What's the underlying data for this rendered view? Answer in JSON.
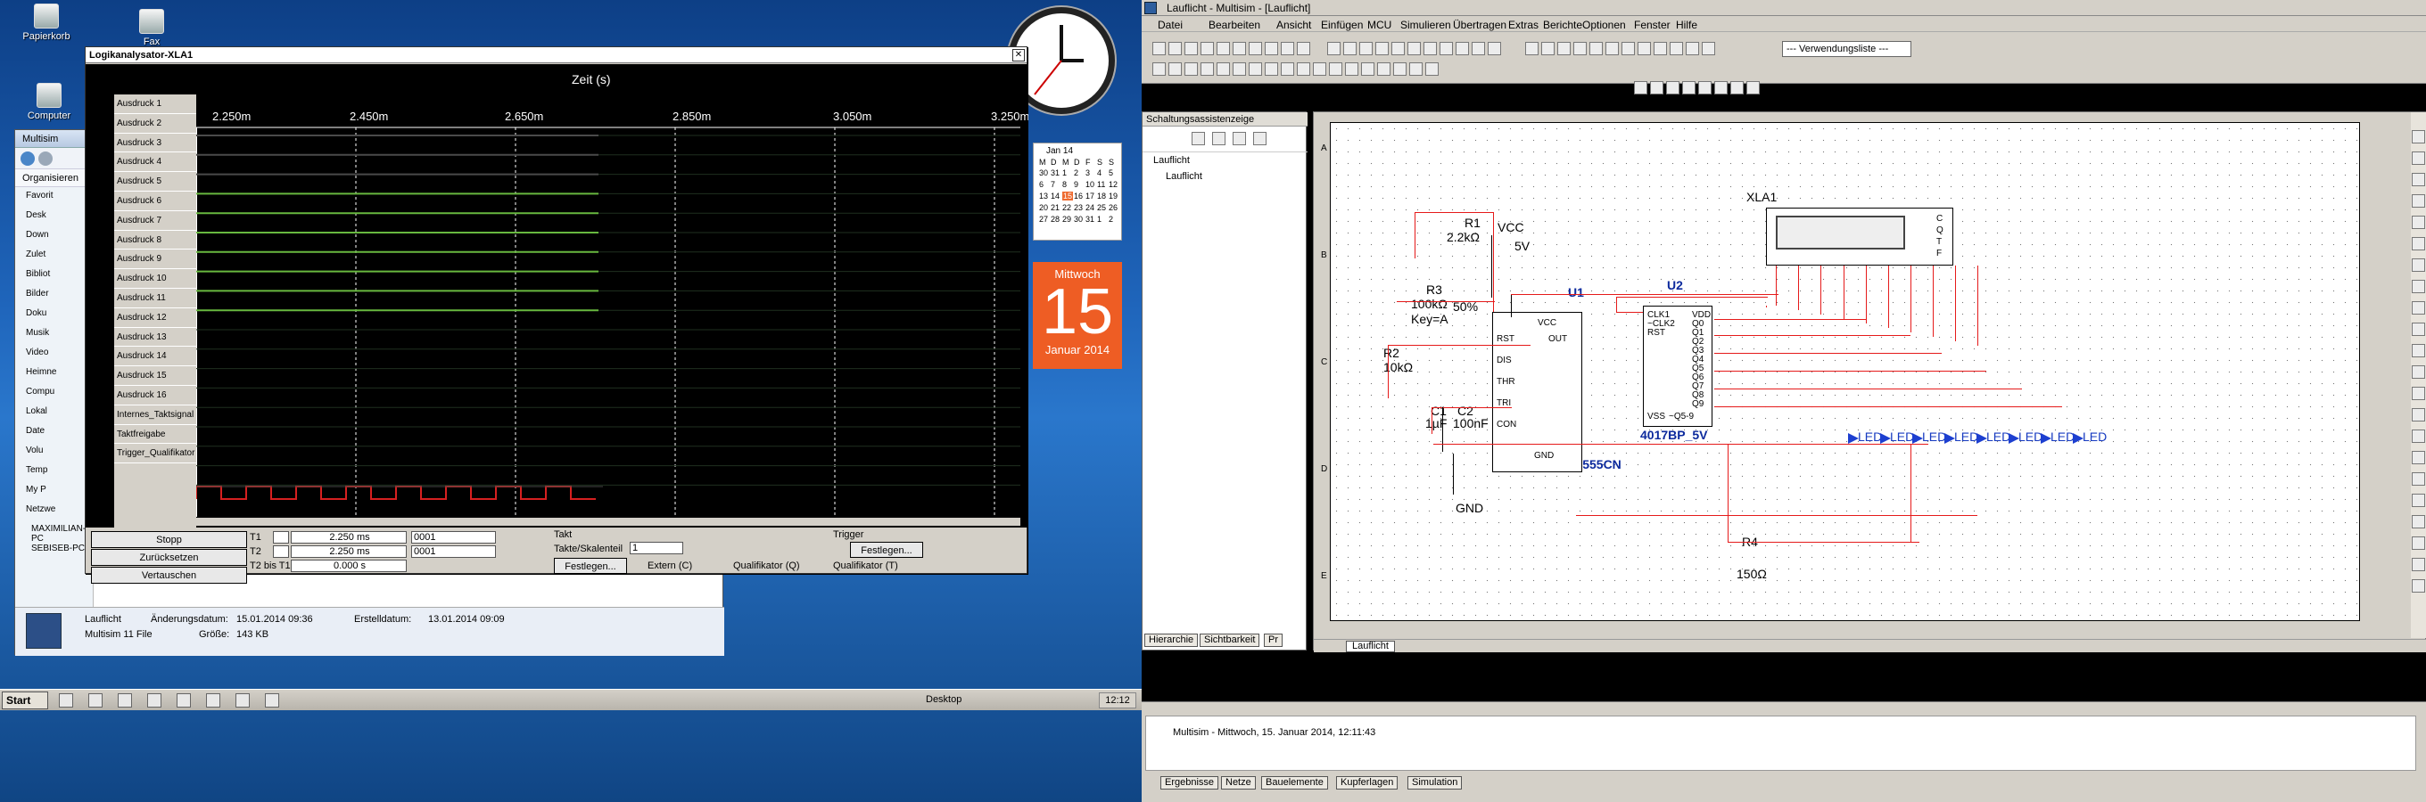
{
  "desktop": {
    "icons": [
      {
        "label": "Papierkorb",
        "icon": "recycle-bin-icon"
      },
      {
        "label": "Fax",
        "icon": "fax-icon"
      },
      {
        "label": "Computer",
        "icon": "computer-icon"
      }
    ]
  },
  "analyzer": {
    "title": "Logikanalysator-XLA1",
    "axis_title": "Zeit (s)",
    "ticks": [
      "2.250m",
      "2.450m",
      "2.650m",
      "2.850m",
      "3.050m",
      "3.250m"
    ],
    "signals": [
      "Ausdruck 1",
      "Ausdruck 2",
      "Ausdruck 3",
      "Ausdruck 4",
      "Ausdruck 5",
      "Ausdruck 6",
      "Ausdruck 7",
      "Ausdruck 8",
      "Ausdruck 9",
      "Ausdruck 10",
      "Ausdruck 11",
      "Ausdruck 12",
      "Ausdruck 13",
      "Ausdruck 14",
      "Ausdruck 15",
      "Ausdruck 16",
      "Internes_Taktsignal",
      "Taktfreigabe",
      "Trigger_Qualifikator"
    ],
    "buttons": {
      "stop": "Stopp",
      "reset": "Zurücksetzen",
      "reverse": "Vertauschen"
    },
    "time_rows": [
      {
        "label": "T1",
        "time": "2.250 ms",
        "value": "0001"
      },
      {
        "label": "T2",
        "time": "2.250 ms",
        "value": "0001"
      },
      {
        "label": "T2 bis T1",
        "time": "0.000 s",
        "value": ""
      }
    ],
    "clock": {
      "title": "Takt",
      "cycles_label": "Takte/Skalenteil",
      "cycles_value": "1",
      "set_button": "Festlegen...",
      "external": "Extern (C)",
      "qualifier": "Qualifikator (Q)"
    },
    "trigger": {
      "title": "Trigger",
      "set_button": "Festlegen...",
      "qualifier": "Qualifikator (T)"
    }
  },
  "explorer": {
    "title": "Multisim",
    "toolbar_label": "Organisieren",
    "nav_items": [
      "Favorit",
      "Desk",
      "Down",
      "Zulet",
      "Bibliot",
      "Bilder",
      "Doku",
      "Musik",
      "Video",
      "Heimne",
      "Compu",
      "Lokal",
      "Date",
      "Volu",
      "Temp",
      "My P",
      "Netzwe",
      "MAXIMILIAN-PC",
      "SEBISEB-PC"
    ],
    "file": {
      "name": "Lauflicht",
      "type": "Multisim 11 File",
      "modified_label": "Änderungsdatum:",
      "modified": "15.01.2014 09:36",
      "created_label": "Erstelldatum:",
      "created": "13.01.2014 09:09",
      "size_label": "Größe:",
      "size": "143 KB"
    }
  },
  "calendar": {
    "month": "Jan 14",
    "weekdays": [
      "M",
      "D",
      "M",
      "D",
      "F",
      "S",
      "S"
    ],
    "days": [
      "30",
      "31",
      "1",
      "2",
      "3",
      "4",
      "5",
      "6",
      "7",
      "8",
      "9",
      "10",
      "11",
      "12",
      "13",
      "14",
      "15",
      "16",
      "17",
      "18",
      "19",
      "20",
      "21",
      "22",
      "23",
      "24",
      "25",
      "26",
      "27",
      "28",
      "29",
      "30",
      "31",
      "1",
      "2"
    ],
    "weekday": "Mittwoch",
    "day": "15",
    "month_year": "Januar 2014"
  },
  "taskbar": {
    "start": "Start",
    "desktop": "Desktop",
    "time": "12:12"
  },
  "multisim": {
    "title": "Lauflicht - Multisim - [Lauflicht]",
    "menu": [
      "Datei",
      "Bearbeiten",
      "Ansicht",
      "Einfügen",
      "MCU",
      "Simulieren",
      "Übertragen",
      "Extras",
      "Berichte",
      "Optionen",
      "Fenster",
      "Hilfe"
    ],
    "dropdown": "--- Verwendungsliste ---",
    "sidebar_title": "Schaltungsassistenzeige",
    "tree": [
      "Lauflicht",
      "Lauflicht"
    ],
    "sidebar_tabs": [
      "Hierarchie",
      "Sichtbarkeit",
      "Pr"
    ],
    "workspace_tab": "Lauflicht",
    "rows": [
      "A",
      "B",
      "C",
      "D",
      "E"
    ],
    "status": "Multisim  -  Mittwoch, 15. Januar 2014, 12:11:43",
    "bottom_tabs": [
      "Ergebnisse",
      "Netze",
      "Bauelemente",
      "Kupferlagen",
      "Simulation"
    ]
  },
  "schematic": {
    "components": {
      "R1": "R1",
      "R1_value": "2.2kΩ",
      "VCC": "VCC",
      "VCC_value": "5V",
      "R3": "R3",
      "R3_value": "100kΩ",
      "R3_key": "Key=A",
      "R3_percent": "50%",
      "R2": "R2",
      "R2_value": "10kΩ",
      "C1": "C1",
      "C1_value": "1µF",
      "C2": "C2",
      "C2_value": "100nF",
      "GND": "GND",
      "U1": "U1",
      "U1_name": "LM555CN",
      "U2": "U2",
      "U2_name": "4017BP_5V",
      "XLA1": "XLA1",
      "R4": "R4",
      "R4_value": "150Ω",
      "LED_label": "LED"
    },
    "u1_pins": [
      "RST",
      "DIS",
      "THR",
      "TRI",
      "CON",
      "VCC",
      "OUT",
      "GND"
    ],
    "u2_pins_left": [
      "CLK1",
      "~CLK2",
      "RST",
      "VSS"
    ],
    "u2_pins_right": [
      "VDD",
      "Q0",
      "Q1",
      "Q2",
      "Q3",
      "Q4",
      "Q5",
      "Q6",
      "Q7",
      "Q8",
      "Q9",
      "~Q5-9"
    ],
    "xla_pins": [
      "C",
      "Q",
      "T",
      "F"
    ]
  }
}
